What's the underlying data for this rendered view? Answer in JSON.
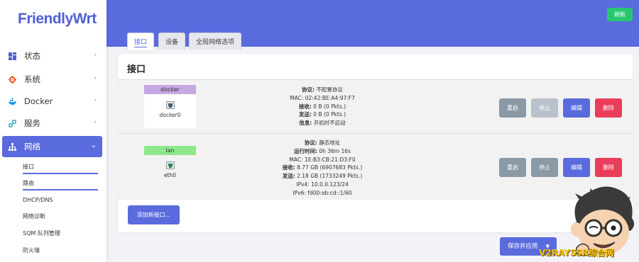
{
  "logo": {
    "text": "FriendlyWrt"
  },
  "header": {
    "refresh_label": "刷新"
  },
  "sidebar": {
    "items": [
      {
        "label": "状态",
        "icon": "dashboard-icon"
      },
      {
        "label": "系统",
        "icon": "gear-icon"
      },
      {
        "label": "Docker",
        "icon": "docker-icon"
      },
      {
        "label": "服务",
        "icon": "services-icon"
      },
      {
        "label": "网络",
        "icon": "network-icon"
      }
    ],
    "subitems": [
      {
        "label": "接口"
      },
      {
        "label": "路由"
      },
      {
        "label": "DHCP/DNS"
      },
      {
        "label": "网络诊断"
      },
      {
        "label": "SQM 队列管理"
      },
      {
        "label": "防火墙"
      }
    ]
  },
  "tabs": [
    {
      "label": "接口"
    },
    {
      "label": "设备"
    },
    {
      "label": "全局网络选项"
    }
  ],
  "section": {
    "title": "接口"
  },
  "interfaces": [
    {
      "name": "docker",
      "name_color": "#c6a8e2",
      "device": "docker0",
      "info": [
        {
          "key": "协议:",
          "value": "不配置协议"
        },
        {
          "key": "",
          "value": "MAC: 02:42:BE:A4:97:F7"
        },
        {
          "key": "接收:",
          "value": "0 B (0 Pkts.)"
        },
        {
          "key": "发送:",
          "value": "0 B (0 Pkts.)"
        },
        {
          "key": "信息:",
          "value": "开机时不启动"
        }
      ]
    },
    {
      "name": "lan",
      "name_color": "#8ee88b",
      "device": "eth0",
      "info": [
        {
          "key": "协议:",
          "value": "静态地址"
        },
        {
          "key": "运行时间:",
          "value": "0h 36m 16s"
        },
        {
          "key": "",
          "value": "MAC: 1E:B3:CB:21:D3:F0"
        },
        {
          "key": "接收:",
          "value": "8.77 GB (6907683 Pkts.)"
        },
        {
          "key": "发送:",
          "value": "2.18 GB (1733249 Pkts.)"
        },
        {
          "key": "",
          "value": "IPv4: 10.0.0.123/24"
        },
        {
          "key": "",
          "value": "IPv6: fd00:ab:cd::1/60"
        }
      ]
    }
  ],
  "actions": {
    "restart": "重启",
    "stop": "停止",
    "edit": "编辑",
    "delete": "删除"
  },
  "add_interface_label": "添加新接口...",
  "save_apply_label": "保存并应用",
  "watermark": "V2RAYSSR综合网",
  "colors": {
    "accent": "#5a6bde",
    "success": "#28c76f",
    "danger": "#ea3d5a"
  }
}
